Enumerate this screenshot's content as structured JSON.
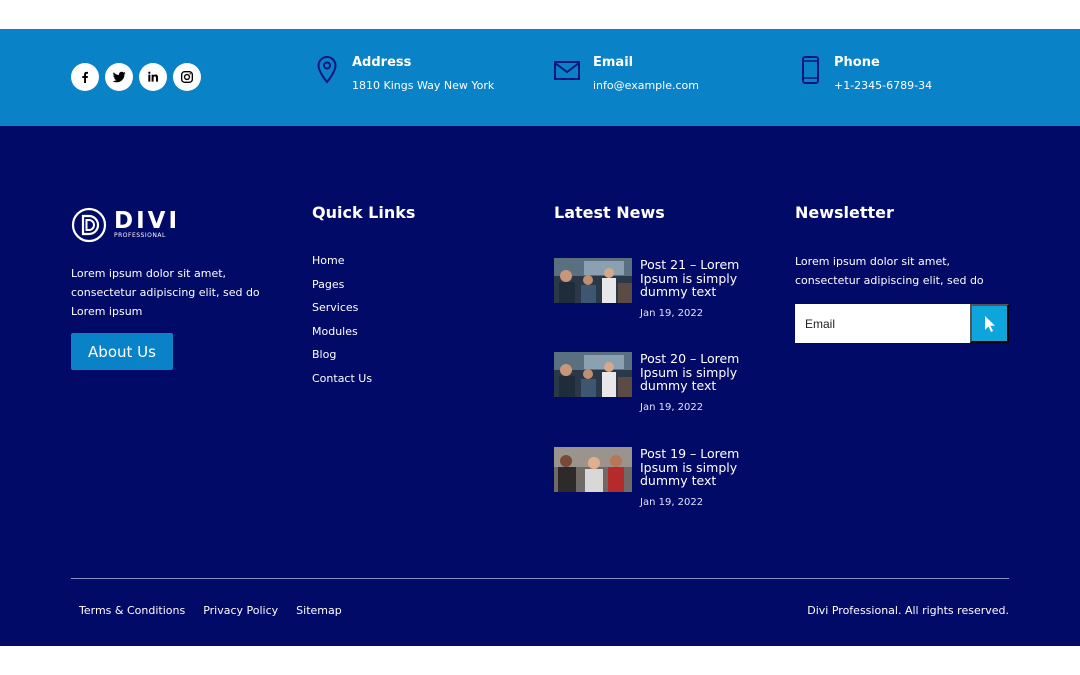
{
  "topbar": {
    "social": [
      {
        "icon": "facebook-icon"
      },
      {
        "icon": "twitter-icon"
      },
      {
        "icon": "linkedin-icon"
      },
      {
        "icon": "instagram-icon"
      }
    ],
    "address": {
      "title": "Address",
      "value": "1810 Kings Way New York",
      "icon": "map-pin-icon"
    },
    "email": {
      "title": "Email",
      "value": "info@example.com",
      "icon": "envelope-icon"
    },
    "phone": {
      "title": "Phone",
      "value": "+1-2345-6789-34",
      "icon": "phone-icon"
    }
  },
  "about": {
    "logo_text": "DIVI",
    "logo_sub": "PROFESSIONAL",
    "text": "Lorem ipsum dolor sit amet, consectetur adipiscing elit, sed do Lorem ipsum",
    "button_label": "About Us"
  },
  "quick_links": {
    "title": "Quick Links",
    "items": [
      "Home",
      "Pages",
      "Services",
      "Modules",
      "Blog",
      "Contact Us"
    ]
  },
  "latest_news": {
    "title": "Latest News",
    "posts": [
      {
        "title": "Post 21 – Lorem Ipsum is simply dummy text",
        "date": "Jan 19, 2022"
      },
      {
        "title": "Post 20 – Lorem Ipsum is simply dummy text",
        "date": "Jan 19, 2022"
      },
      {
        "title": "Post 19 – Lorem Ipsum is simply dummy text",
        "date": "Jan 19, 2022"
      }
    ]
  },
  "newsletter": {
    "title": "Newsletter",
    "text": "Lorem ipsum dolor sit amet, consectetur adipiscing elit, sed do",
    "placeholder": "Email",
    "submit_icon": "cursor-pointer-icon"
  },
  "footer": {
    "links": [
      "Terms & Conditions",
      "Privacy Policy",
      "Sitemap"
    ],
    "copyright": "Divi Professional. All rights reserved."
  },
  "colors": {
    "topbar": "#0a82c8",
    "main_bg": "#010a66",
    "accent": "#0ea5dc",
    "icon_dark": "#0a1580"
  }
}
